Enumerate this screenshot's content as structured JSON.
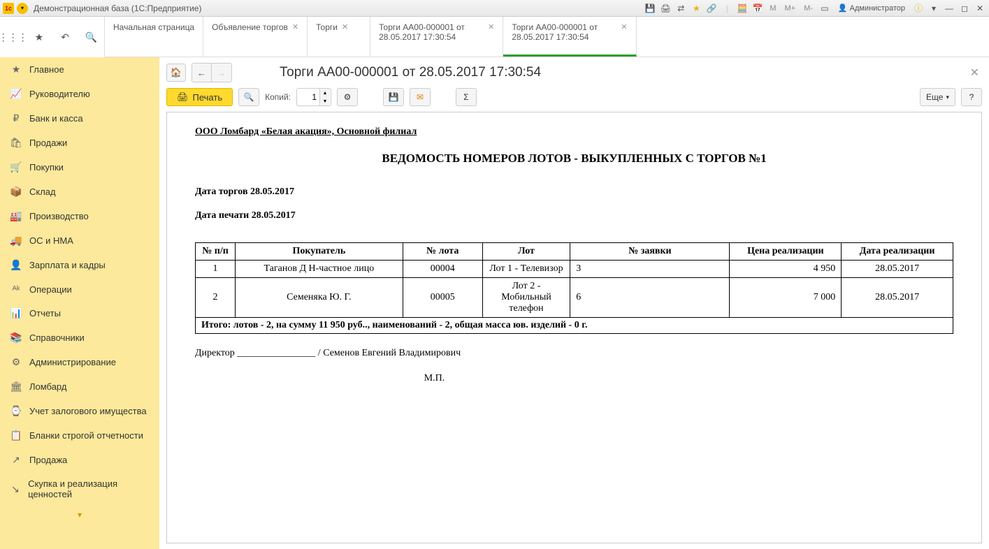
{
  "titlebar": {
    "title": "Демонстрационная база  (1С:Предприятие)",
    "user": "Администратор",
    "m_labels": [
      "M",
      "M+",
      "M-"
    ]
  },
  "tabs": [
    {
      "label": "Начальная страница",
      "closable": false
    },
    {
      "label": "Объявление торгов",
      "closable": true
    },
    {
      "label": "Торги",
      "closable": true
    },
    {
      "label": "Торги АА00-000001 от 28.05.2017 17:30:54",
      "closable": true
    },
    {
      "label": "Торги АА00-000001 от 28.05.2017 17:30:54",
      "closable": true,
      "active": true
    }
  ],
  "sidebar": {
    "items": [
      {
        "icon": "★",
        "label": "Главное"
      },
      {
        "icon": "📈",
        "label": "Руководителю"
      },
      {
        "icon": "₽",
        "label": "Банк и касса"
      },
      {
        "icon": "🛍",
        "label": "Продажи"
      },
      {
        "icon": "🛒",
        "label": "Покупки"
      },
      {
        "icon": "📦",
        "label": "Склад"
      },
      {
        "icon": "🏭",
        "label": "Производство"
      },
      {
        "icon": "🚚",
        "label": "ОС и НМА"
      },
      {
        "icon": "👤",
        "label": "Зарплата и кадры"
      },
      {
        "icon": "ᴬᵏ",
        "label": "Операции"
      },
      {
        "icon": "📊",
        "label": "Отчеты"
      },
      {
        "icon": "📚",
        "label": "Справочники"
      },
      {
        "icon": "⚙",
        "label": "Администрирование"
      },
      {
        "icon": "🏛",
        "label": "Ломбард"
      },
      {
        "icon": "⌚",
        "label": "Учет залогового имущества"
      },
      {
        "icon": "📋",
        "label": "Бланки строгой отчетности"
      },
      {
        "icon": "↗",
        "label": "Продажа"
      },
      {
        "icon": "↘",
        "label": "Скупка и реализация ценностей"
      }
    ]
  },
  "document": {
    "title": "Торги АА00-000001 от 28.05.2017 17:30:54",
    "toolbar": {
      "print_label": "Печать",
      "copies_label": "Копий:",
      "copies_value": "1",
      "more_label": "Еще"
    },
    "report": {
      "company": "ООО Ломбард «Белая акация», Основной филиал",
      "main_title": "ВЕДОМОСТЬ НОМЕРОВ ЛОТОВ - ВЫКУПЛЕННЫХ С ТОРГОВ №1",
      "auction_date_label": "Дата торгов 28.05.2017",
      "print_date_label": "Дата печати 28.05.2017",
      "headers": {
        "num": "№ п/п",
        "buyer": "Покупатель",
        "lot_num": "№ лота",
        "lot": "Лот",
        "bid_num": "№ заявки",
        "price": "Цена реализации",
        "date": "Дата реализации"
      },
      "rows": [
        {
          "num": "1",
          "buyer": "Таганов Д Н-частное лицо",
          "lot_num": "00004",
          "lot": "Лот 1 - Телевизор",
          "bid_num": "3",
          "price": "4 950",
          "date": "28.05.2017"
        },
        {
          "num": "2",
          "buyer": "Семеняка Ю. Г.",
          "lot_num": "00005",
          "lot": "Лот 2 - Мобильный телефон",
          "bid_num": "6",
          "price": "7 000",
          "date": "28.05.2017"
        }
      ],
      "total": "Итого: лотов - 2, на сумму 11 950 руб.., наименований - 2, общая масса юв. изделий - 0 г.",
      "signature": "Директор ________________ / Семенов Евгений Владимирович",
      "stamp": "М.П."
    }
  }
}
